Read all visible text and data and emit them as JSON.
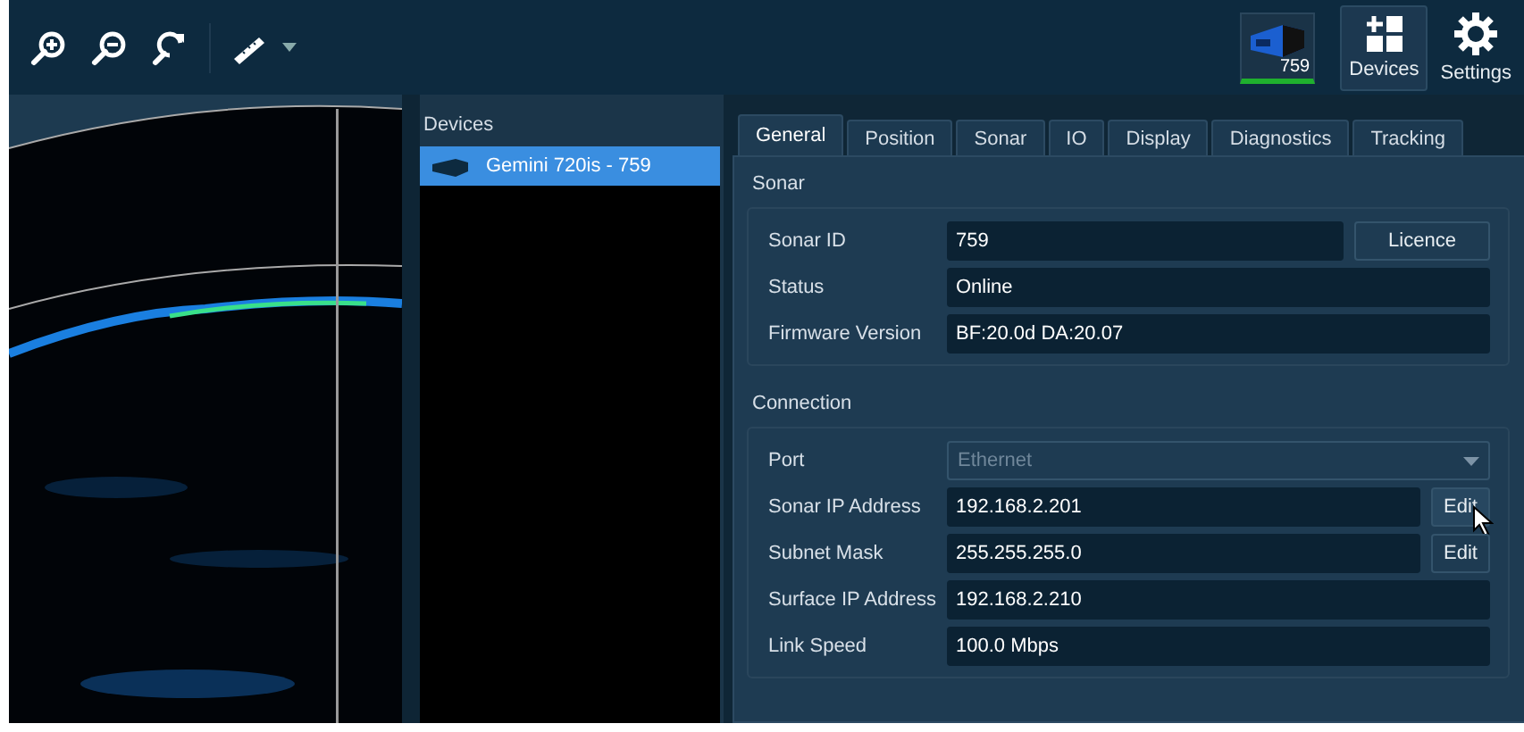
{
  "toolbar": {
    "tools": [
      {
        "kind": "zoom-in"
      },
      {
        "kind": "zoom-out"
      },
      {
        "kind": "reset"
      },
      {
        "kind": "ruler"
      }
    ],
    "device_badge": {
      "label": "759"
    },
    "buttons": [
      {
        "label": "Devices",
        "kind": "devices",
        "selected": true
      },
      {
        "label": "Settings",
        "kind": "settings",
        "selected": false
      }
    ]
  },
  "devices_panel": {
    "title": "Devices",
    "items": [
      {
        "label": "Gemini 720is - 759",
        "selected": true
      }
    ]
  },
  "tabs": [
    {
      "label": "General",
      "selected": true
    },
    {
      "label": "Position",
      "selected": false
    },
    {
      "label": "Sonar",
      "selected": false
    },
    {
      "label": "IO",
      "selected": false
    },
    {
      "label": "Display",
      "selected": false
    },
    {
      "label": "Diagnostics",
      "selected": false
    },
    {
      "label": "Tracking",
      "selected": false
    }
  ],
  "sections": [
    {
      "title": "Sonar",
      "rows": [
        {
          "kind": "text",
          "label": "Sonar ID",
          "value": "759",
          "button": "Licence"
        },
        {
          "kind": "text",
          "label": "Status",
          "value": "Online"
        },
        {
          "kind": "text",
          "label": "Firmware Version",
          "value": "BF:20.0d DA:20.07"
        }
      ]
    },
    {
      "title": "Connection",
      "rows": [
        {
          "kind": "dropdown",
          "label": "Port",
          "value": "Ethernet",
          "disabled": true
        },
        {
          "kind": "text",
          "label": "Sonar IP Address",
          "value": "192.168.2.201",
          "button": "Edit",
          "hovered": true
        },
        {
          "kind": "text",
          "label": "Subnet Mask",
          "value": "255.255.255.0",
          "button": "Edit"
        },
        {
          "kind": "text",
          "label": "Surface IP Address",
          "value": "192.168.2.210"
        },
        {
          "kind": "text",
          "label": "Link Speed",
          "value": "100.0 Mbps"
        }
      ]
    }
  ]
}
